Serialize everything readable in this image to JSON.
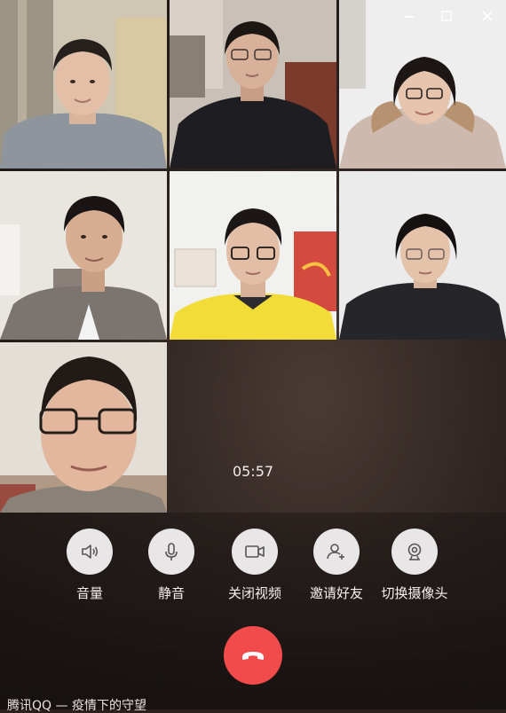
{
  "call": {
    "timer": "05:57",
    "participants": [
      {
        "name": "participant-1"
      },
      {
        "name": "participant-2"
      },
      {
        "name": "participant-3"
      },
      {
        "name": "participant-4"
      },
      {
        "name": "participant-5"
      },
      {
        "name": "participant-6"
      },
      {
        "name": "participant-7"
      }
    ]
  },
  "window_controls": {
    "icons": [
      "minimize-icon",
      "maximize-icon",
      "close-icon"
    ]
  },
  "controls": [
    {
      "label": "音量",
      "icon": "speaker-icon"
    },
    {
      "label": "静音",
      "icon": "microphone-icon"
    },
    {
      "label": "关闭视频",
      "icon": "video-camera-icon"
    },
    {
      "label": "邀请好友",
      "icon": "add-user-icon"
    },
    {
      "label": "切换摄像头",
      "icon": "webcam-icon"
    }
  ],
  "hangup": {
    "icon": "hang-up-icon",
    "color": "#f24b4b"
  },
  "caption": "腾讯QQ — 疫情下的守望",
  "colors": {
    "background": "#2d2320",
    "button_bg": "#e8e6e6",
    "hangup": "#f24b4b",
    "text": "#f4f0ee"
  }
}
